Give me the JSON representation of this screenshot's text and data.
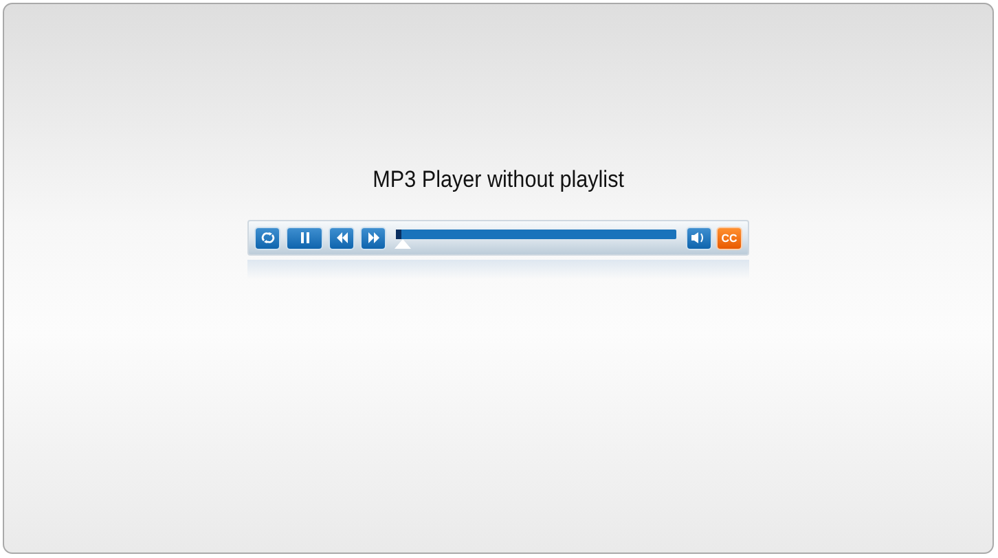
{
  "title": "MP3 Player without playlist",
  "player": {
    "progress": {
      "level": 0.02
    },
    "cc_label": "CC",
    "playing": true
  }
}
